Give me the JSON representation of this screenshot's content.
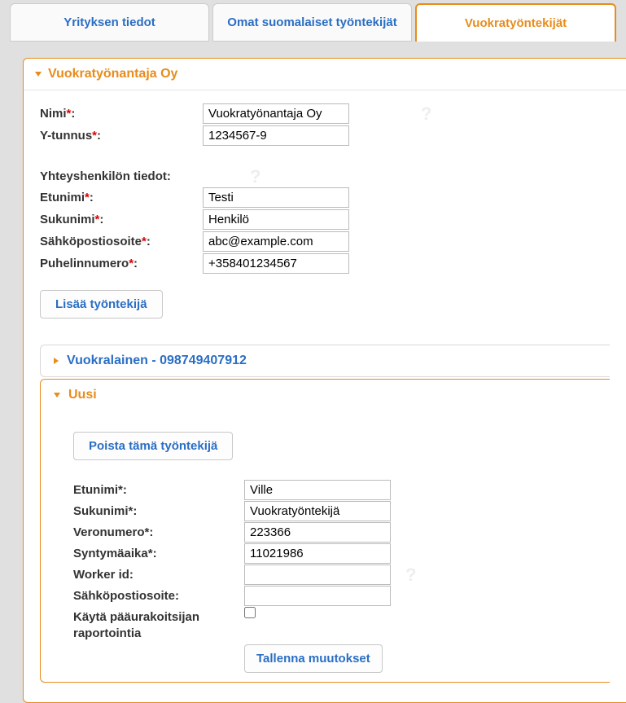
{
  "tabs": {
    "company": "Yrityksen tiedot",
    "own_workers": "Omat suomalaiset työntekijät",
    "rental_workers": "Vuokratyöntekijät"
  },
  "employer_panel": {
    "title": "Vuokratyönantaja Oy",
    "fields": {
      "name_label": "Nimi",
      "name_value": "Vuokratyönantaja Oy",
      "ytunnus_label": "Y-tunnus",
      "ytunnus_value": "1234567-9",
      "contact_heading": "Yhteyshenkilön tiedot:",
      "firstname_label": "Etunimi",
      "firstname_value": "Testi",
      "lastname_label": "Sukunimi",
      "lastname_value": "Henkilö",
      "email_label": "Sähköpostiosoite",
      "email_value": "abc@example.com",
      "phone_label": "Puhelinnumero",
      "phone_value": "+358401234567"
    },
    "add_worker_btn": "Lisää työntekijä"
  },
  "tenant_panel": {
    "title": "Vuokralainen - 098749407912"
  },
  "new_panel": {
    "title": "Uusi",
    "remove_btn": "Poista tämä työntekijä",
    "fields": {
      "firstname_label": "Etunimi",
      "firstname_value": "Ville",
      "lastname_label": "Sukunimi",
      "lastname_value": "Vuokratyöntekijä",
      "taxnum_label": "Veronumero",
      "taxnum_value": "223366",
      "dob_label": "Syntymäaika",
      "dob_value": "11021986",
      "workerid_label": "Worker id:",
      "workerid_value": "",
      "email_label": "Sähköpostiosoite:",
      "email_value": "",
      "maincontractor_label": "Käytä pääurakoitsijan raportointia"
    },
    "save_btn": "Tallenna muutokset"
  }
}
